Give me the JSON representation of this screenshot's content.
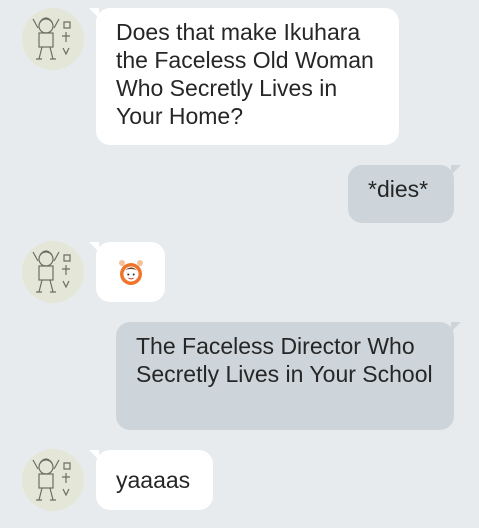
{
  "chat": {
    "messages": [
      {
        "sender": "contact",
        "text": "Does that make Ikuhara the Faceless Old Woman Who Secretly Lives in Your Home?",
        "icon": "avatar-sketch-icon"
      },
      {
        "sender": "me",
        "text": "*dies*"
      },
      {
        "sender": "contact",
        "sticker": "person-raising-hands-emoji-icon",
        "icon": "avatar-sketch-icon"
      },
      {
        "sender": "me",
        "text": "The Faceless Director Who Secretly Lives in Your School"
      },
      {
        "sender": "contact",
        "text": "yaaaas",
        "icon": "avatar-sketch-icon"
      }
    ]
  },
  "colors": {
    "background": "#e7ebee",
    "incoming_bubble": "#ffffff",
    "outgoing_bubble": "#cdd5da",
    "text": "#262626",
    "emoji_orange": "#f0752a"
  }
}
